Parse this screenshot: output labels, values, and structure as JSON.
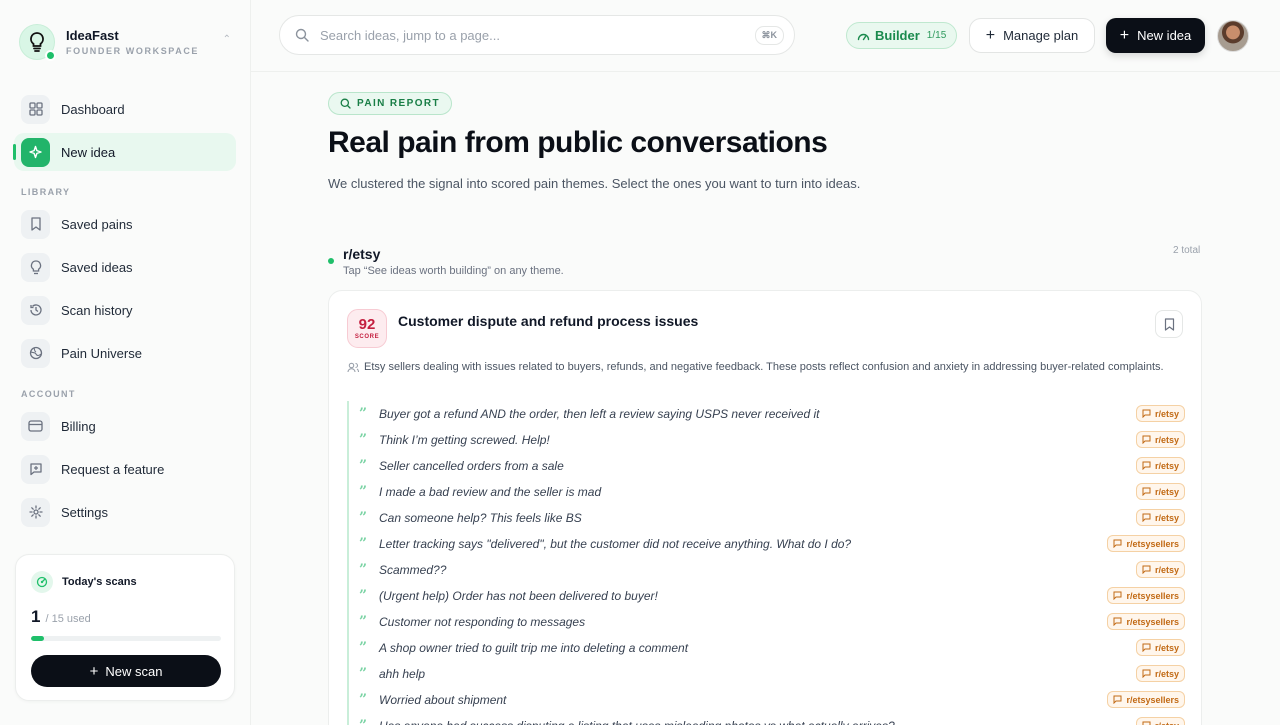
{
  "brand": {
    "name": "IdeaFast",
    "subtitle": "FOUNDER WORKSPACE"
  },
  "nav": {
    "dashboard": "Dashboard",
    "new_idea": "New idea",
    "library_heading": "LIBRARY",
    "saved_pains": "Saved pains",
    "saved_ideas": "Saved ideas",
    "scan_history": "Scan history",
    "pain_universe": "Pain Universe",
    "account_heading": "ACCOUNT",
    "billing": "Billing",
    "request_feature": "Request a feature",
    "settings": "Settings"
  },
  "scans": {
    "title": "Today's scans",
    "used": "1",
    "limit_label": "/ 15 used",
    "progress_fraction": 0.067,
    "button": "New scan"
  },
  "topbar": {
    "search_placeholder": "Search ideas, jump to a page...",
    "shortcut": "⌘K",
    "plan_name": "Builder",
    "plan_quota": "1/15",
    "manage_plan": "Manage plan",
    "new_idea": "New idea"
  },
  "report": {
    "pill": "PAIN REPORT",
    "title": "Real pain from public conversations",
    "lede": "We clustered the signal into scored pain themes. Select the ones you want to turn into ideas."
  },
  "group": {
    "name": "r/etsy",
    "hint": "Tap “See ideas worth building” on any theme.",
    "total": "2 total"
  },
  "card": {
    "score": "92",
    "score_label": "SCORE",
    "title": "Customer dispute and refund process issues",
    "description": "Etsy sellers dealing with issues related to buyers, refunds, and negative feedback. These posts reflect confusion and anxiety in addressing buyer-related complaints.",
    "quotes": [
      {
        "text": "Buyer got a refund AND the order, then left a review saying USPS never received it",
        "source": "r/etsy"
      },
      {
        "text": "Think I’m getting screwed. Help!",
        "source": "r/etsy"
      },
      {
        "text": "Seller cancelled orders from a sale",
        "source": "r/etsy"
      },
      {
        "text": "I made a bad review and the seller is mad",
        "source": "r/etsy"
      },
      {
        "text": "Can someone help? This feels like BS",
        "source": "r/etsy"
      },
      {
        "text": "Letter tracking says \"delivered\", but the customer did not receive anything. What do I do?",
        "source": "r/etsysellers"
      },
      {
        "text": "Scammed??",
        "source": "r/etsy"
      },
      {
        "text": "(Urgent help) Order has not been delivered to buyer!",
        "source": "r/etsysellers"
      },
      {
        "text": "Customer not responding to messages",
        "source": "r/etsysellers"
      },
      {
        "text": "A shop owner tried to guilt trip me into deleting a comment",
        "source": "r/etsy"
      },
      {
        "text": "ahh help",
        "source": "r/etsy"
      },
      {
        "text": "Worried about shipment",
        "source": "r/etsysellers"
      },
      {
        "text": "Has anyone had success disputing a listing that uses misleading photos vs what actually arrives?",
        "source": "r/etsy"
      }
    ]
  },
  "colors": {
    "accent": "#1fbf6a",
    "dark": "#0b0f17",
    "score_red": "#c41f3f",
    "tag_orange": "#c26a15"
  }
}
